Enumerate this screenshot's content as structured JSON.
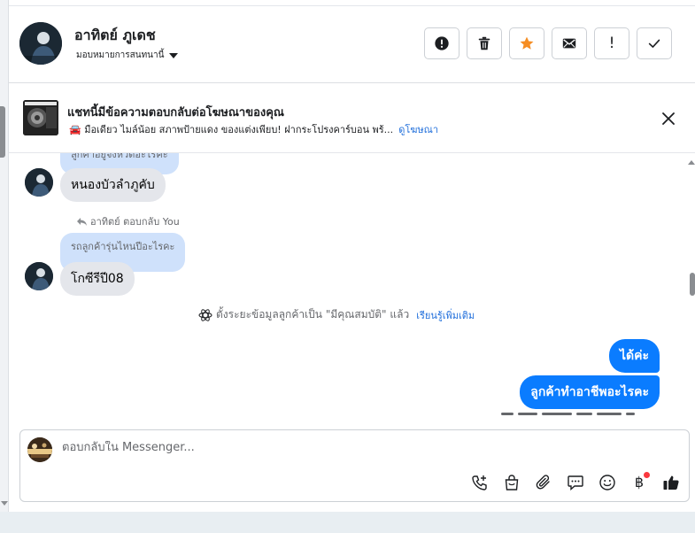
{
  "header": {
    "contact_name": "อาทิตย์ ภูเดช",
    "assign_label": "มอบหมายการสนทนานี้",
    "actions": [
      {
        "icon": "alert-circle-icon",
        "name": "mark-spam-button"
      },
      {
        "icon": "trash-icon",
        "name": "delete-button"
      },
      {
        "icon": "star-icon",
        "name": "star-button"
      },
      {
        "icon": "mail-icon",
        "name": "mark-unread-button"
      },
      {
        "icon": "exclamation-icon",
        "glyph": "!",
        "name": "follow-up-button"
      },
      {
        "icon": "check-icon",
        "name": "mark-done-button"
      }
    ],
    "star_color": "#f58d23"
  },
  "banner": {
    "title": "แชทนี้มีข้อความตอบกลับต่อโฆษณาของคุณ",
    "description": "🚘 มือเดียว ไมล์น้อย สภาพป้ายแดง ของแต่งเพียบ! ฝากระโปรงคาร์บอน พร้...",
    "ad_link": "ดูโฆษณา"
  },
  "messages": {
    "quoted_top": "ลูกค้าอยู่จังหวัดอะไรคะ",
    "reply_1": "หนองบัวลำภูคับ",
    "reply_meta": "อาทิตย์ ตอบกลับ You",
    "quoted_2": "รถลูกค้ารุ่นไหนปีอะไรคะ",
    "reply_2": "โกซีรีปี08",
    "system_note": "ตั้งระยะข้อมูลลูกค้าเป็น \"มีคุณสมบัติ\" แล้ว",
    "system_link": "เรียนรู้เพิ่มเติม",
    "out_1": "ได้ค่ะ",
    "out_2": "ลูกค้าทำอาชีพอะไรคะ"
  },
  "composer": {
    "placeholder": "ตอบกลับใน Messenger...",
    "tools": [
      "phone-add-icon",
      "shopping-bag-icon",
      "paperclip-icon",
      "chat-bubble-icon",
      "smiley-icon",
      "baht-icon",
      "thumbs-up-icon"
    ],
    "baht_glyph": "฿"
  },
  "colors": {
    "outgoing_bubble": "#0a7cff",
    "incoming_bubble": "#e4e6eb",
    "quoted_bubble": "#cfe1fb",
    "link": "#216fdb",
    "notification_dot": "#fa383e"
  }
}
